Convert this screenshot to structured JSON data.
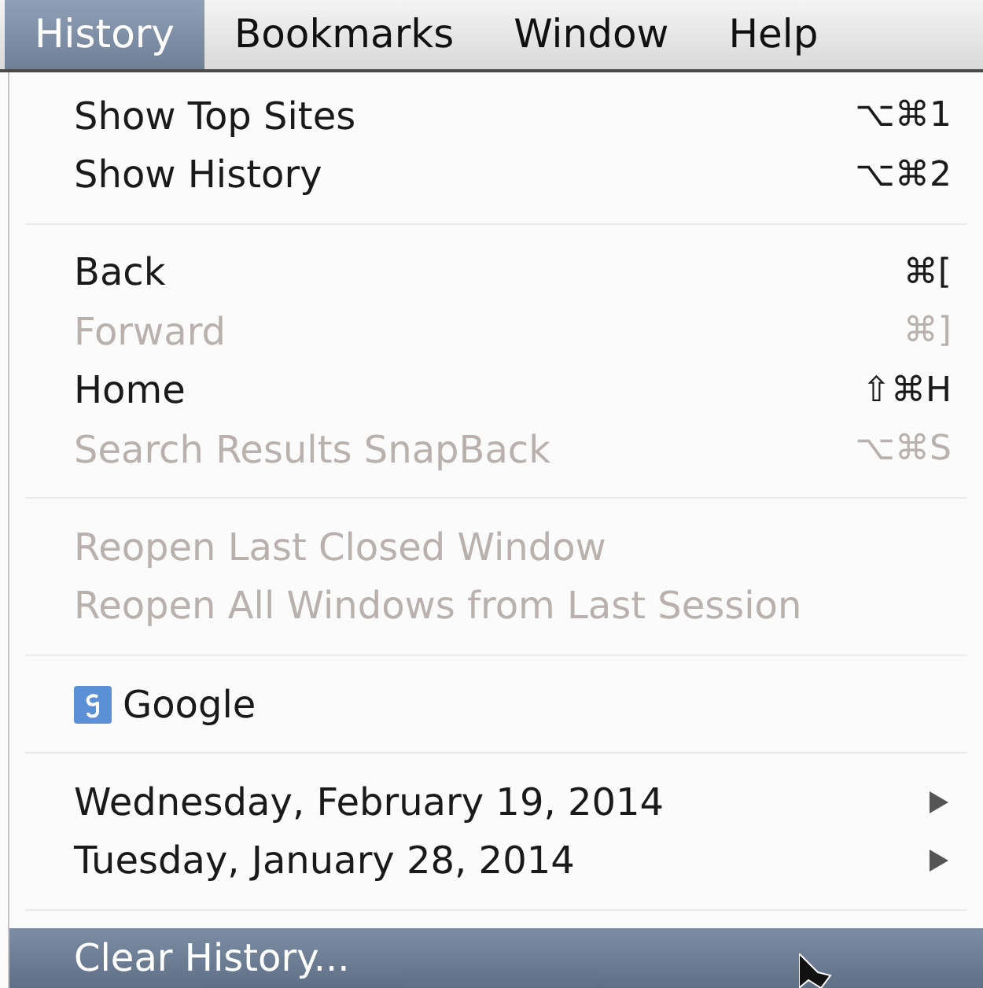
{
  "menu_bar": [
    {
      "label": "History",
      "selected": true
    },
    {
      "label": "Bookmarks",
      "selected": false
    },
    {
      "label": "Window",
      "selected": false
    },
    {
      "label": "Help",
      "selected": false
    }
  ],
  "menu": {
    "items": [
      {
        "kind": "item",
        "label": "Show Top Sites",
        "shortcut": "⌥⌘1",
        "disabled": false,
        "selected": false
      },
      {
        "kind": "item",
        "label": "Show History",
        "shortcut": "⌥⌘2",
        "disabled": false,
        "selected": false
      },
      {
        "kind": "separator"
      },
      {
        "kind": "item",
        "label": "Back",
        "shortcut": "⌘[",
        "disabled": false,
        "selected": false
      },
      {
        "kind": "item",
        "label": "Forward",
        "shortcut": "⌘]",
        "disabled": true,
        "selected": false
      },
      {
        "kind": "item",
        "label": "Home",
        "shortcut": "⇧⌘H",
        "disabled": false,
        "selected": false
      },
      {
        "kind": "item",
        "label": "Search Results SnapBack",
        "shortcut": "⌥⌘S",
        "disabled": true,
        "selected": false
      },
      {
        "kind": "separator"
      },
      {
        "kind": "item",
        "label": "Reopen Last Closed Window",
        "disabled": true,
        "selected": false
      },
      {
        "kind": "item",
        "label": "Reopen All Windows from Last Session",
        "disabled": true,
        "selected": false
      },
      {
        "kind": "separator"
      },
      {
        "kind": "bookmark",
        "label": "Google",
        "disabled": false,
        "selected": false
      },
      {
        "kind": "separator"
      },
      {
        "kind": "submenu",
        "label": "Wednesday, February 19, 2014",
        "disabled": false,
        "selected": false
      },
      {
        "kind": "submenu",
        "label": "Tuesday, January 28, 2014",
        "disabled": false,
        "selected": false
      },
      {
        "kind": "separator"
      },
      {
        "kind": "item",
        "label": "Clear History...",
        "disabled": false,
        "selected": true
      }
    ]
  }
}
